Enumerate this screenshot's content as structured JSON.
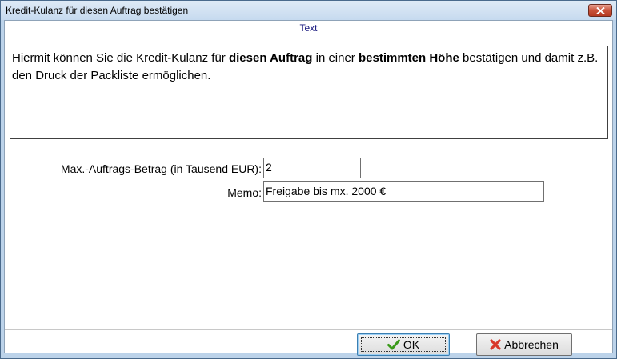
{
  "window": {
    "title": "Kredit-Kulanz für diesen Auftrag bestätigen"
  },
  "section_label": "Text",
  "description": {
    "part1": "Hiermit können Sie die Kredit-Kulanz für ",
    "bold1": "diesen Auftrag",
    "part2": " in einer ",
    "bold2": "bestimmten Höhe",
    "part3": " bestätigen und damit z.B. den Druck der Packliste ermöglichen."
  },
  "form": {
    "max_amount_label": "Max.-Auftrags-Betrag (in Tausend EUR):",
    "max_amount_value": "2",
    "memo_label": "Memo:",
    "memo_value": "Freigabe bis mx. 2000 €"
  },
  "buttons": {
    "ok_label": "OK",
    "cancel_label": "Abbrechen"
  },
  "icons": {
    "ok": "checkmark-icon",
    "cancel": "x-icon",
    "close": "close-icon"
  }
}
